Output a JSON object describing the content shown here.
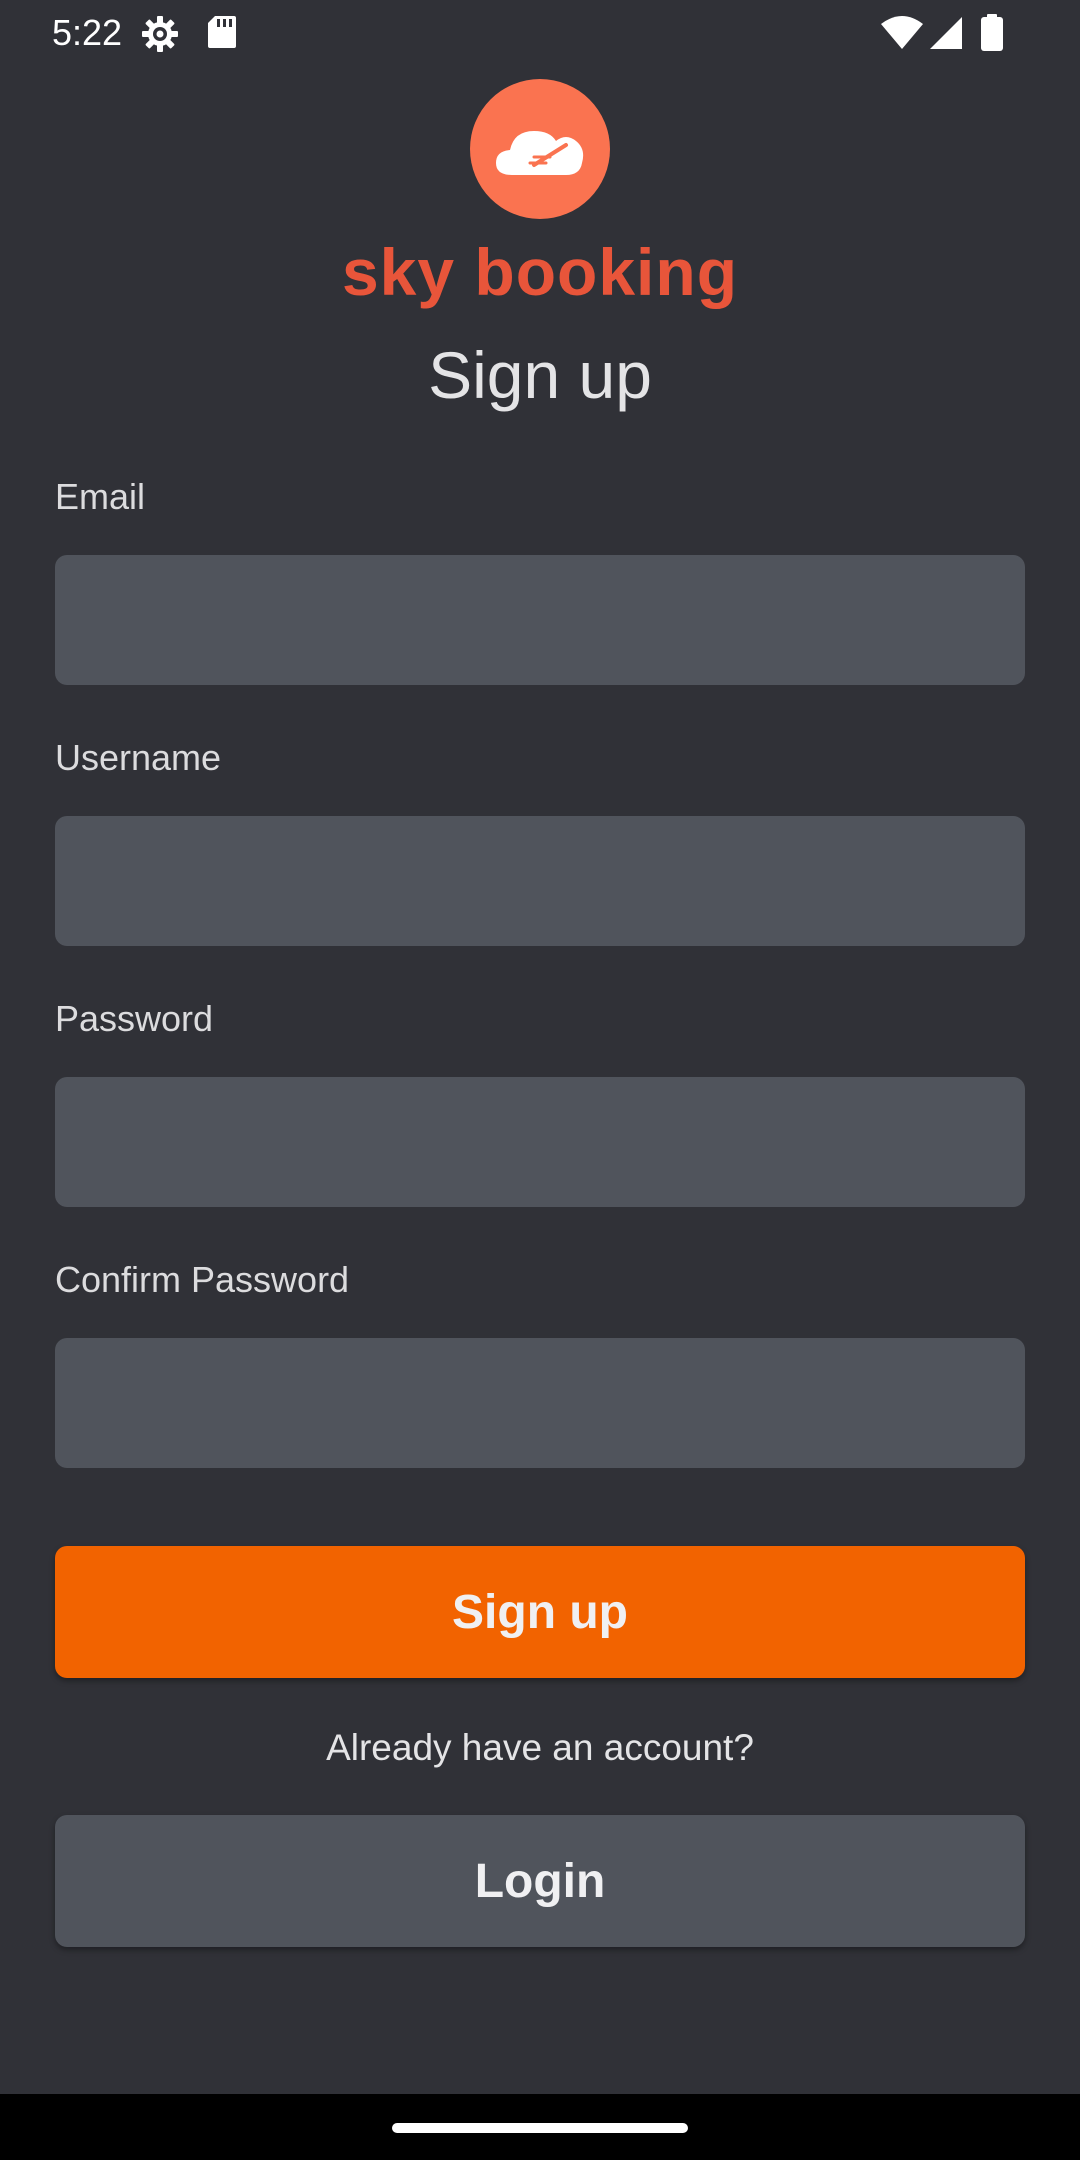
{
  "status_bar": {
    "time": "5:22",
    "icons": [
      "settings-gear-icon",
      "sd-card-icon",
      "wifi-icon",
      "cellular-signal-icon",
      "battery-icon"
    ]
  },
  "brand": {
    "logo_icon": "cloud-plane-icon",
    "name": "sky booking",
    "logo_color": "#fa7350",
    "name_color": "#e8553a"
  },
  "page": {
    "title": "Sign up"
  },
  "form": {
    "email": {
      "label": "Email",
      "value": "",
      "placeholder": ""
    },
    "username": {
      "label": "Username",
      "value": "",
      "placeholder": ""
    },
    "password": {
      "label": "Password",
      "value": "",
      "placeholder": ""
    },
    "confirm_password": {
      "label": "Confirm Password",
      "value": "",
      "placeholder": ""
    }
  },
  "actions": {
    "signup_label": "Sign up",
    "signup_color": "#f26300",
    "already_text": "Already have an account?",
    "login_label": "Login"
  },
  "theme": {
    "background": "#303137",
    "input_background": "#50545c"
  }
}
